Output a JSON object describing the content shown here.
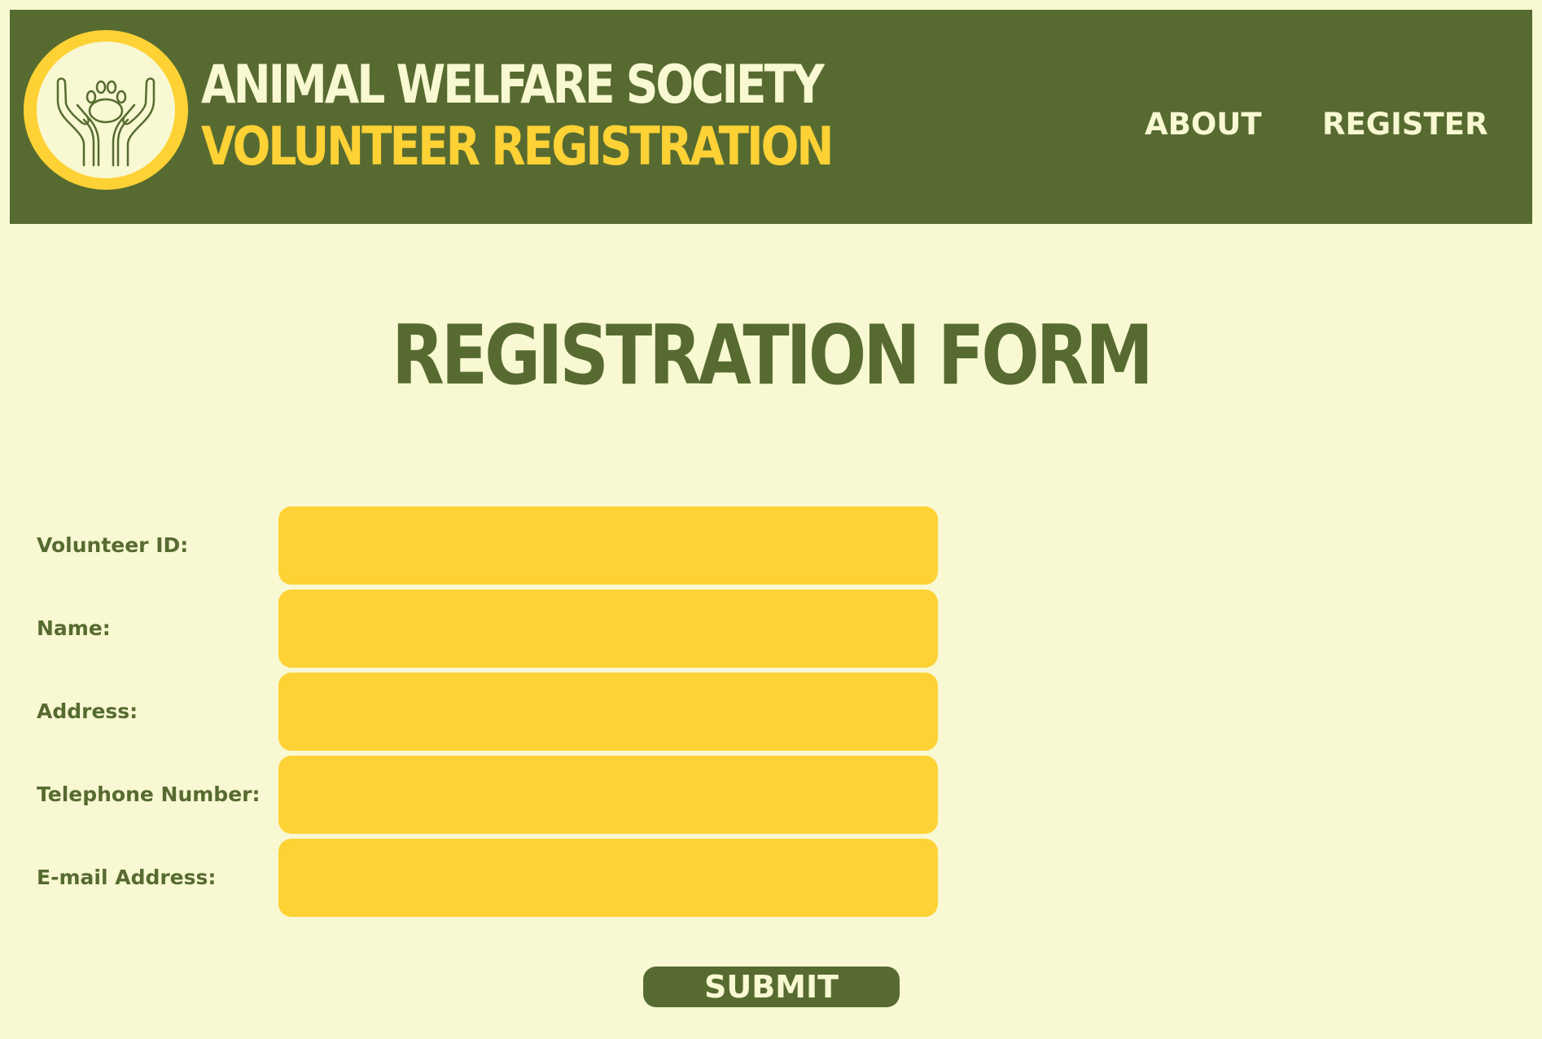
{
  "header": {
    "brand_title": "ANIMAL WELFARE SOCIETY",
    "brand_subtitle": "VOLUNTEER REGISTRATION",
    "logo_icon": "hands-holding-paw-icon",
    "nav": [
      {
        "label": "ABOUT"
      },
      {
        "label": "REGISTER"
      }
    ]
  },
  "main": {
    "title": "REGISTRATION FORM",
    "fields": [
      {
        "label": "Volunteer ID:",
        "value": ""
      },
      {
        "label": "Name:",
        "value": ""
      },
      {
        "label": "Address:",
        "value": ""
      },
      {
        "label": "Telephone Number:",
        "value": ""
      },
      {
        "label": "E-mail Address:",
        "value": ""
      }
    ],
    "submit_label": "SUBMIT"
  },
  "colors": {
    "background": "#f8f8d2",
    "header": "#576b31",
    "accent": "#fed235",
    "text_dark": "#576b31",
    "text_light": "#f8f8d2"
  }
}
